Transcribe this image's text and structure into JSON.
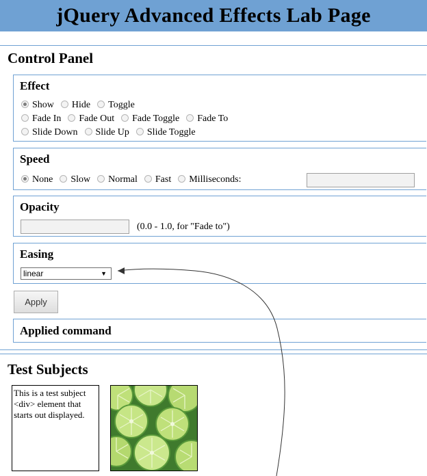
{
  "page_title": "jQuery Advanced Effects Lab Page",
  "control_panel": {
    "title": "Control Panel",
    "effect": {
      "legend": "Effect",
      "rows": [
        [
          {
            "label": "Show",
            "checked": true
          },
          {
            "label": "Hide",
            "checked": false
          },
          {
            "label": "Toggle",
            "checked": false
          }
        ],
        [
          {
            "label": "Fade In",
            "checked": false
          },
          {
            "label": "Fade Out",
            "checked": false
          },
          {
            "label": "Fade Toggle",
            "checked": false
          },
          {
            "label": "Fade To",
            "checked": false
          }
        ],
        [
          {
            "label": "Slide Down",
            "checked": false
          },
          {
            "label": "Slide Up",
            "checked": false
          },
          {
            "label": "Slide Toggle",
            "checked": false
          }
        ]
      ]
    },
    "speed": {
      "legend": "Speed",
      "options": [
        {
          "label": "None",
          "checked": true
        },
        {
          "label": "Slow",
          "checked": false
        },
        {
          "label": "Normal",
          "checked": false
        },
        {
          "label": "Fast",
          "checked": false
        },
        {
          "label": "Milliseconds:",
          "checked": false
        }
      ],
      "milliseconds_value": ""
    },
    "opacity": {
      "legend": "Opacity",
      "value": "",
      "hint": "(0.0 - 1.0, for \"Fade to\")"
    },
    "easing": {
      "legend": "Easing",
      "selected": "linear"
    },
    "apply_label": "Apply",
    "applied_command": {
      "legend": "Applied command",
      "value": ""
    }
  },
  "test_subjects": {
    "title": "Test Subjects",
    "div_text": "This is a test subject <div> element that starts out displayed.",
    "image_subject": "limes-image"
  },
  "colors": {
    "banner": "#6fa1d3",
    "border": "#6fa1d3"
  }
}
